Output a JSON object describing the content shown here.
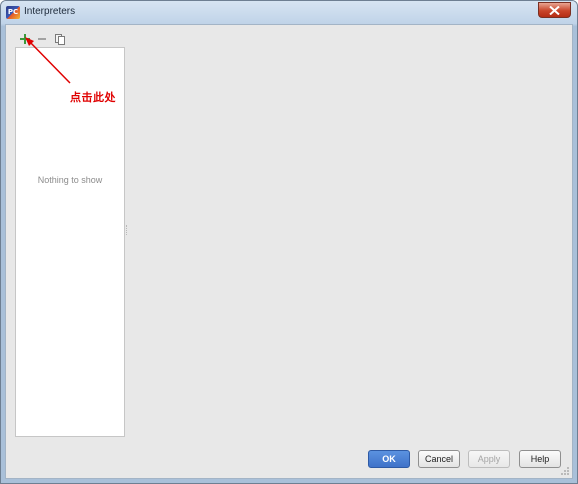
{
  "window": {
    "title": "Interpreters",
    "app_icon_text": "PC"
  },
  "toolbar": {
    "add_icon": "plus-icon",
    "remove_icon": "minus-icon",
    "copy_icon": "copy-icon",
    "add_color": "#3a9a3a"
  },
  "list": {
    "empty_text": "Nothing to show"
  },
  "annotation": {
    "label": "点击此处",
    "color": "#e00000"
  },
  "buttons": {
    "ok": "OK",
    "cancel": "Cancel",
    "apply": "Apply",
    "help": "Help"
  }
}
